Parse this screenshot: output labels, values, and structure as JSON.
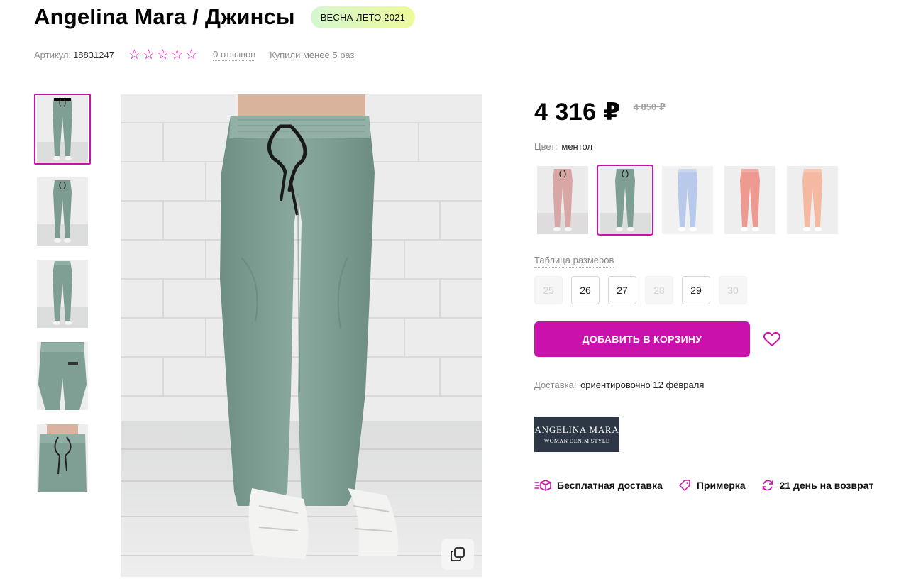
{
  "product": {
    "title": "Angelina Mara / Джинсы",
    "season_badge": "ВЕСНА-ЛЕТО 2021",
    "article_label": "Артикул:",
    "article_value": "18831247",
    "rating": 0,
    "rating_max": 5,
    "reviews": "0 отзывов",
    "bought": "Купили менее 5 раз"
  },
  "gallery": {
    "thumbnails": [
      "front-full",
      "front-full-2",
      "back-full",
      "back-closeup",
      "waist-closeup"
    ],
    "active_index": 0,
    "expand_icon": "expand-icon"
  },
  "price": {
    "current": "4 316 ₽",
    "old": "4 850 ₽"
  },
  "color": {
    "label": "Цвет:",
    "value": "ментол",
    "swatches": [
      {
        "name": "pink",
        "hex": "#d9a6a6"
      },
      {
        "name": "mint",
        "hex": "#7f9f94"
      },
      {
        "name": "light-blue",
        "hex": "#b9c9ec"
      },
      {
        "name": "coral",
        "hex": "#ef9a90"
      },
      {
        "name": "peach",
        "hex": "#f4b9a0"
      }
    ],
    "active_index": 1
  },
  "sizes": {
    "table_link": "Таблица размеров",
    "options": [
      {
        "label": "25",
        "available": false
      },
      {
        "label": "26",
        "available": true
      },
      {
        "label": "27",
        "available": true
      },
      {
        "label": "28",
        "available": false
      },
      {
        "label": "29",
        "available": true
      },
      {
        "label": "30",
        "available": false
      }
    ]
  },
  "cart": {
    "button_label": "ДОБАВИТЬ В КОРЗИНУ",
    "favorite_icon": "heart-icon"
  },
  "delivery": {
    "label": "Доставка:",
    "value": "ориентировочно 12 февраля"
  },
  "brand": {
    "line1": "ANGELINA MARA",
    "line2": "WOMAN DENIM STYLE"
  },
  "features": [
    {
      "icon": "delivery-box-icon",
      "label": "Бесплатная доставка"
    },
    {
      "icon": "tag-icon",
      "label": "Примерка"
    },
    {
      "icon": "return-icon",
      "label": "21 день на возврат"
    }
  ],
  "colors": {
    "accent": "#cb11ab",
    "pants_mint": "#7f9f94",
    "brand_bg": "#2d3746"
  }
}
